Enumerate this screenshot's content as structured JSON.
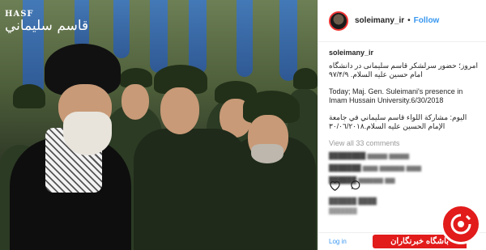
{
  "post": {
    "watermark_latin": "HASF",
    "watermark_arabic": "قاسم سليماني"
  },
  "header": {
    "username": "soleimany_ir",
    "separator": "•",
    "follow_label": "Follow"
  },
  "caption": {
    "username": "soleimany_ir",
    "persian": "امروز؛ حضور سرلشکر قاسم سلیمانی در دانشگاه امام حسین علیه السلام. ۹۷/۴/۹",
    "english": "Today; Maj. Gen. Suleimani's presence in Imam Hussain University.6/30/2018",
    "arabic": "اليوم: مشاركة اللواء قاسم سليماني في جامعة الإمام الحسين عليه السلام.٣٠/٠٦/٢٠١٨"
  },
  "comments": {
    "view_all": "View all 33 comments"
  },
  "footer": {
    "login": "Log in"
  },
  "logo": {
    "label": "باشگاه خبرنگاران"
  },
  "colors": {
    "link": "#3897f0",
    "brand_red": "#e21b1b"
  }
}
